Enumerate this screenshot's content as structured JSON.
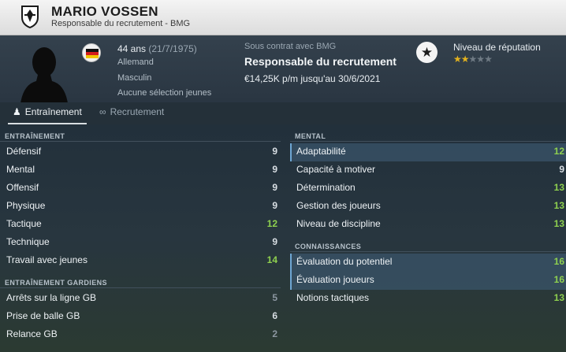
{
  "header": {
    "name": "MARIO VOSSEN",
    "subtitle": "Responsable du recrutement - BMG"
  },
  "profile": {
    "age": "44 ans",
    "dob": "(21/7/1975)",
    "nationality": "Allemand",
    "gender": "Masculin",
    "youth_caps": "Aucune sélection jeunes",
    "contract_label": "Sous contrat avec BMG",
    "contract_role": "Responsable du recrutement",
    "contract_wage": "€14,25K p/m jusqu'au 30/6/2021",
    "reputation_label": "Niveau de réputation",
    "reputation_stars": 2,
    "reputation_max": 5
  },
  "tabs": [
    {
      "label": "Entraînement",
      "icon": "trainer-icon",
      "active": true
    },
    {
      "label": "Recrutement",
      "icon": "binoculars-icon",
      "active": false
    }
  ],
  "colors": {
    "value_normal": "#d8dee3",
    "value_good": "#8fd14f",
    "value_low": "#8c97a1",
    "star_on": "#e3b21f",
    "highlight_border": "#6ea6d3"
  },
  "left": {
    "training": {
      "title": "ENTRAÎNEMENT",
      "rows": [
        {
          "label": "Défensif",
          "value": "9"
        },
        {
          "label": "Mental",
          "value": "9"
        },
        {
          "label": "Offensif",
          "value": "9"
        },
        {
          "label": "Physique",
          "value": "9"
        },
        {
          "label": "Tactique",
          "value": "12"
        },
        {
          "label": "Technique",
          "value": "9"
        },
        {
          "label": "Travail avec jeunes",
          "value": "14"
        }
      ]
    },
    "goalkeeping": {
      "title": "ENTRAÎNEMENT GARDIENS",
      "rows": [
        {
          "label": "Arrêts sur la ligne GB",
          "value": "5"
        },
        {
          "label": "Prise de balle GB",
          "value": "6"
        },
        {
          "label": "Relance GB",
          "value": "2"
        }
      ]
    }
  },
  "right": {
    "mental": {
      "title": "MENTAL",
      "rows": [
        {
          "label": "Adaptabilité",
          "value": "12",
          "highlight": true
        },
        {
          "label": "Capacité à motiver",
          "value": "9"
        },
        {
          "label": "Détermination",
          "value": "13"
        },
        {
          "label": "Gestion des joueurs",
          "value": "13"
        },
        {
          "label": "Niveau de discipline",
          "value": "13"
        }
      ]
    },
    "knowledge": {
      "title": "CONNAISSANCES",
      "rows": [
        {
          "label": "Évaluation du potentiel",
          "value": "16",
          "highlight": true
        },
        {
          "label": "Évaluation joueurs",
          "value": "16",
          "highlight": true
        },
        {
          "label": "Notions tactiques",
          "value": "13"
        }
      ]
    }
  }
}
